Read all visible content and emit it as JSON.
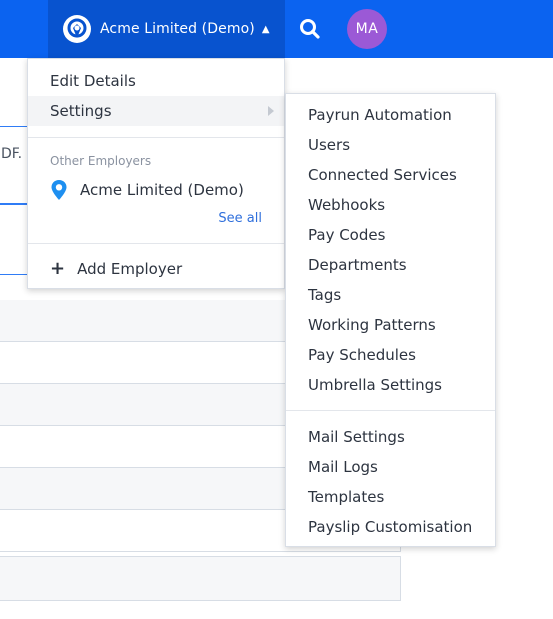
{
  "header": {
    "employer_name": "Acme Limited (Demo)",
    "avatar_initials": "MA",
    "colors": {
      "bar": "#0b63f0",
      "employer_button": "#0853cf",
      "avatar": "#9b59d6"
    }
  },
  "background": {
    "field_fragment": "DF."
  },
  "employer_menu": {
    "edit_details": "Edit Details",
    "settings": "Settings",
    "other_employers_label": "Other Employers",
    "employers": [
      "Acme Limited (Demo)"
    ],
    "see_all": "See all",
    "add_employer": "Add Employer"
  },
  "settings_menu": {
    "items": [
      "Payrun Automation",
      "Users",
      "Connected Services",
      "Webhooks",
      "Pay Codes",
      "Departments",
      "Tags",
      "Working Patterns",
      "Pay Schedules",
      "Umbrella Settings"
    ],
    "mail_items": [
      "Mail Settings",
      "Mail Logs",
      "Templates",
      "Payslip Customisation"
    ]
  }
}
